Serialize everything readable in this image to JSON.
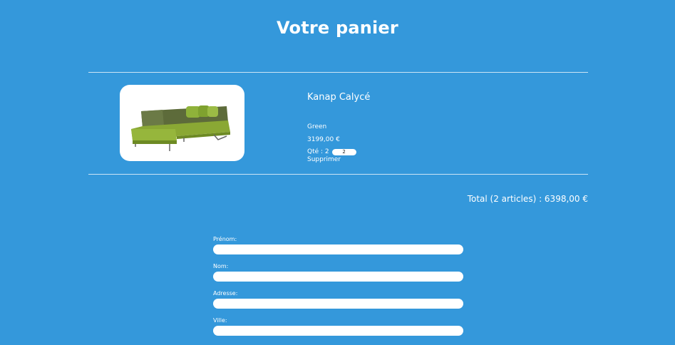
{
  "page": {
    "title": "Votre panier"
  },
  "cart": {
    "items": [
      {
        "name": "Kanap Calycé",
        "color": "Green",
        "price": "3199,00 €",
        "quantity_label": "Qté : 2",
        "quantity_value": "2",
        "delete_label": "Supprimer",
        "image_icon": "sofa-image"
      }
    ],
    "total": "Total (2 articles) : 6398,00 €"
  },
  "form": {
    "firstname_label": "Prénom:",
    "lastname_label": "Nom:",
    "address_label": "Adresse:",
    "city_label": "Ville:"
  },
  "colors": {
    "background": "#3498db",
    "text": "#ffffff",
    "input": "#ffffff"
  }
}
